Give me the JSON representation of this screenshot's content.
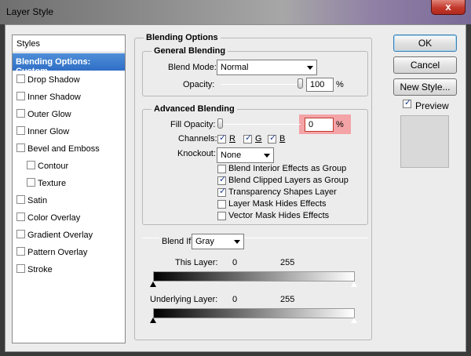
{
  "window": {
    "title": "Layer Style",
    "close_label": "x"
  },
  "styles_panel": {
    "header": "Styles",
    "active_item": "Blending Options: Custom",
    "items": [
      {
        "label": "Drop Shadow",
        "checked": false,
        "indent": false
      },
      {
        "label": "Inner Shadow",
        "checked": false,
        "indent": false
      },
      {
        "label": "Outer Glow",
        "checked": false,
        "indent": false
      },
      {
        "label": "Inner Glow",
        "checked": false,
        "indent": false
      },
      {
        "label": "Bevel and Emboss",
        "checked": false,
        "indent": false
      },
      {
        "label": "Contour",
        "checked": false,
        "indent": true
      },
      {
        "label": "Texture",
        "checked": false,
        "indent": true
      },
      {
        "label": "Satin",
        "checked": false,
        "indent": false
      },
      {
        "label": "Color Overlay",
        "checked": false,
        "indent": false
      },
      {
        "label": "Gradient Overlay",
        "checked": false,
        "indent": false
      },
      {
        "label": "Pattern Overlay",
        "checked": false,
        "indent": false
      },
      {
        "label": "Stroke",
        "checked": false,
        "indent": false
      }
    ]
  },
  "blending_options": {
    "title": "Blending Options",
    "general": {
      "title": "General Blending",
      "blend_mode_label": "Blend Mode:",
      "blend_mode_value": "Normal",
      "opacity_label": "Opacity:",
      "opacity_value": "100",
      "opacity_unit": "%",
      "opacity_level": 1.0
    },
    "advanced": {
      "title": "Advanced Blending",
      "fill_opacity_label": "Fill Opacity:",
      "fill_opacity_value": "0",
      "fill_opacity_unit": "%",
      "fill_opacity_level": 0.0,
      "channels_label": "Channels:",
      "channels": [
        {
          "label": "R",
          "checked": true
        },
        {
          "label": "G",
          "checked": true
        },
        {
          "label": "B",
          "checked": true
        }
      ],
      "knockout_label": "Knockout:",
      "knockout_value": "None",
      "options": [
        {
          "label": "Blend Interior Effects as Group",
          "checked": false
        },
        {
          "label": "Blend Clipped Layers as Group",
          "checked": true
        },
        {
          "label": "Transparency Shapes Layer",
          "checked": true
        },
        {
          "label": "Layer Mask Hides Effects",
          "checked": false
        },
        {
          "label": "Vector Mask Hides Effects",
          "checked": false
        }
      ]
    },
    "blend_if": {
      "label": "Blend If:",
      "value": "Gray",
      "this_layer_label": "This Layer:",
      "this_layer_min": "0",
      "this_layer_max": "255",
      "underlying_label": "Underlying Layer:",
      "underlying_min": "0",
      "underlying_max": "255"
    }
  },
  "buttons": {
    "ok": "OK",
    "cancel": "Cancel",
    "new_style": "New Style..."
  },
  "preview": {
    "label": "Preview",
    "checked": true
  },
  "colors": {
    "highlight": "#f4a3a6",
    "selection": "#2f6ec6",
    "close": "#c3392c"
  }
}
